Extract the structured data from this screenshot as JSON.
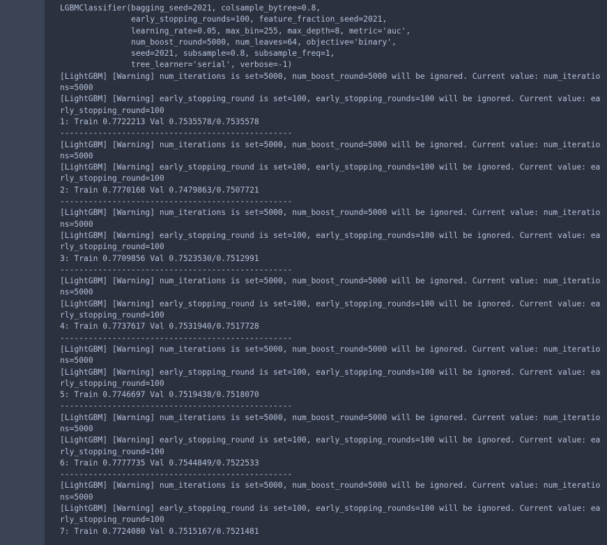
{
  "cell": {
    "kind": "jupyter-notebook-output-cell",
    "theme": "dark",
    "colors": {
      "gutter_background": "#3b4454",
      "output_background": "#2b313f",
      "text": "#b6c2d9"
    }
  },
  "estimator_repr": {
    "lines": [
      "LGBMClassifier(bagging_seed=2021, colsample_bytree=0.8,",
      "               early_stopping_rounds=100, feature_fraction_seed=2021,",
      "               learning_rate=0.05, max_bin=255, max_depth=8, metric='auc',",
      "               num_boost_round=5000, num_leaves=64, objective='binary',",
      "               seed=2021, subsample=0.8, subsample_freq=1,",
      "               tree_learner='serial', verbose=-1)"
    ],
    "full_text": "LGBMClassifier(bagging_seed=2021, colsample_bytree=0.8,\n               early_stopping_rounds=100, feature_fraction_seed=2021,\n               learning_rate=0.05, max_bin=255, max_depth=8, metric='auc',\n               num_boost_round=5000, num_leaves=64, objective='binary',\n               seed=2021, subsample=0.8, subsample_freq=1,\n               tree_learner='serial', verbose=-1)",
    "params": {
      "bagging_seed": "2021",
      "colsample_bytree": "0.8",
      "early_stopping_rounds": "100",
      "feature_fraction_seed": "2021",
      "learning_rate": "0.05",
      "max_bin": "255",
      "max_depth": "8",
      "metric": "'auc'",
      "num_boost_round": "5000",
      "num_leaves": "64",
      "objective": "'binary'",
      "seed": "2021",
      "subsample": "0.8",
      "subsample_freq": "1",
      "tree_learner": "'serial'",
      "verbose": "-1"
    }
  },
  "log": {
    "warning_num_iterations": "[LightGBM] [Warning] num_iterations is set=5000, num_boost_round=5000 will be ignored. Current value: num_iterations=5000",
    "warning_early_stopping": "[LightGBM] [Warning] early_stopping_round is set=100, early_stopping_rounds=100 will be ignored. Current value: early_stopping_round=100",
    "separator": "-------------------------------------------------",
    "folds": [
      {
        "index": "1",
        "train_auc": "0.7722213",
        "val_auc": "0.7535578",
        "oof_auc": "0.7535578",
        "line": "1: Train 0.7722213 Val 0.7535578/0.7535578"
      },
      {
        "index": "2",
        "train_auc": "0.7770168",
        "val_auc": "0.7479863",
        "oof_auc": "0.7507721",
        "line": "2: Train 0.7770168 Val 0.7479863/0.7507721"
      },
      {
        "index": "3",
        "train_auc": "0.7709856",
        "val_auc": "0.7523530",
        "oof_auc": "0.7512991",
        "line": "3: Train 0.7709856 Val 0.7523530/0.7512991"
      },
      {
        "index": "4",
        "train_auc": "0.7737617",
        "val_auc": "0.7531940",
        "oof_auc": "0.7517728",
        "line": "4: Train 0.7737617 Val 0.7531940/0.7517728"
      },
      {
        "index": "5",
        "train_auc": "0.7746697",
        "val_auc": "0.7519438",
        "oof_auc": "0.7518070",
        "line": "5: Train 0.7746697 Val 0.7519438/0.7518070"
      },
      {
        "index": "6",
        "train_auc": "0.7777735",
        "val_auc": "0.7544849",
        "oof_auc": "0.7522533",
        "line": "6: Train 0.7777735 Val 0.7544849/0.7522533"
      },
      {
        "index": "7",
        "train_auc": "0.7724080",
        "val_auc": "0.7515167",
        "oof_auc": "0.7521481",
        "line": "7: Train 0.7724080 Val 0.7515167/0.7521481"
      }
    ],
    "stream_text": "[LightGBM] [Warning] num_iterations is set=5000, num_boost_round=5000 will be ignored. Current value: num_iterations=5000\n[LightGBM] [Warning] early_stopping_round is set=100, early_stopping_rounds=100 will be ignored. Current value: early_stopping_round=100\n1: Train 0.7722213 Val 0.7535578/0.7535578\n-------------------------------------------------\n[LightGBM] [Warning] num_iterations is set=5000, num_boost_round=5000 will be ignored. Current value: num_iterations=5000\n[LightGBM] [Warning] early_stopping_round is set=100, early_stopping_rounds=100 will be ignored. Current value: early_stopping_round=100\n2: Train 0.7770168 Val 0.7479863/0.7507721\n-------------------------------------------------\n[LightGBM] [Warning] num_iterations is set=5000, num_boost_round=5000 will be ignored. Current value: num_iterations=5000\n[LightGBM] [Warning] early_stopping_round is set=100, early_stopping_rounds=100 will be ignored. Current value: early_stopping_round=100\n3: Train 0.7709856 Val 0.7523530/0.7512991\n-------------------------------------------------\n[LightGBM] [Warning] num_iterations is set=5000, num_boost_round=5000 will be ignored. Current value: num_iterations=5000\n[LightGBM] [Warning] early_stopping_round is set=100, early_stopping_rounds=100 will be ignored. Current value: early_stopping_round=100\n4: Train 0.7737617 Val 0.7531940/0.7517728\n-------------------------------------------------\n[LightGBM] [Warning] num_iterations is set=5000, num_boost_round=5000 will be ignored. Current value: num_iterations=5000\n[LightGBM] [Warning] early_stopping_round is set=100, early_stopping_rounds=100 will be ignored. Current value: early_stopping_round=100\n5: Train 0.7746697 Val 0.7519438/0.7518070\n-------------------------------------------------\n[LightGBM] [Warning] num_iterations is set=5000, num_boost_round=5000 will be ignored. Current value: num_iterations=5000\n[LightGBM] [Warning] early_stopping_round is set=100, early_stopping_rounds=100 will be ignored. Current value: early_stopping_round=100\n6: Train 0.7777735 Val 0.7544849/0.7522533\n-------------------------------------------------\n[LightGBM] [Warning] num_iterations is set=5000, num_boost_round=5000 will be ignored. Current value: num_iterations=5000\n[LightGBM] [Warning] early_stopping_round is set=100, early_stopping_rounds=100 will be ignored. Current value: early_stopping_round=100\n7: Train 0.7724080 Val 0.7515167/0.7521481"
  }
}
